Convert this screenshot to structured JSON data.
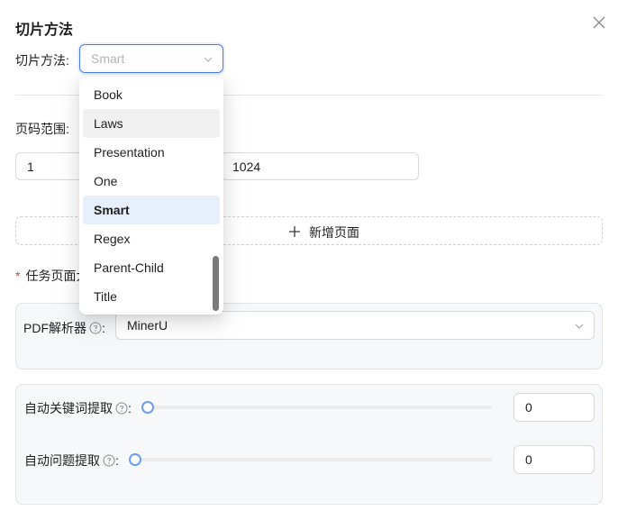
{
  "dialog": {
    "title": "切片方法",
    "close_icon": "close-icon"
  },
  "chunk_method": {
    "label": "切片方法:",
    "placeholder": "Smart",
    "options": [
      "Book",
      "Laws",
      "Presentation",
      "One",
      "Smart",
      "Regex",
      "Parent-Child",
      "Title"
    ],
    "hovered_option": "Laws",
    "selected_option": "Smart"
  },
  "page_range": {
    "label": "页码范围:",
    "start": "1",
    "end": "1024"
  },
  "add_page": {
    "label": "新增页面"
  },
  "task_page": {
    "required_mark": "*",
    "label": "任务页面大"
  },
  "pdf_parser": {
    "label": "PDF解析器",
    "colon": ":",
    "value": "MinerU"
  },
  "auto_keywords": {
    "label": "自动关键词提取",
    "colon": ":",
    "value": "0",
    "slider_fraction": 0
  },
  "auto_questions": {
    "label": "自动问题提取",
    "colon": ":",
    "value": "0",
    "slider_fraction": 0
  },
  "colors": {
    "accent": "#4a7cf7",
    "required": "#e53935",
    "selected_option_bg": "#e6f0fd",
    "hover_option_bg": "#f0f0f0"
  }
}
